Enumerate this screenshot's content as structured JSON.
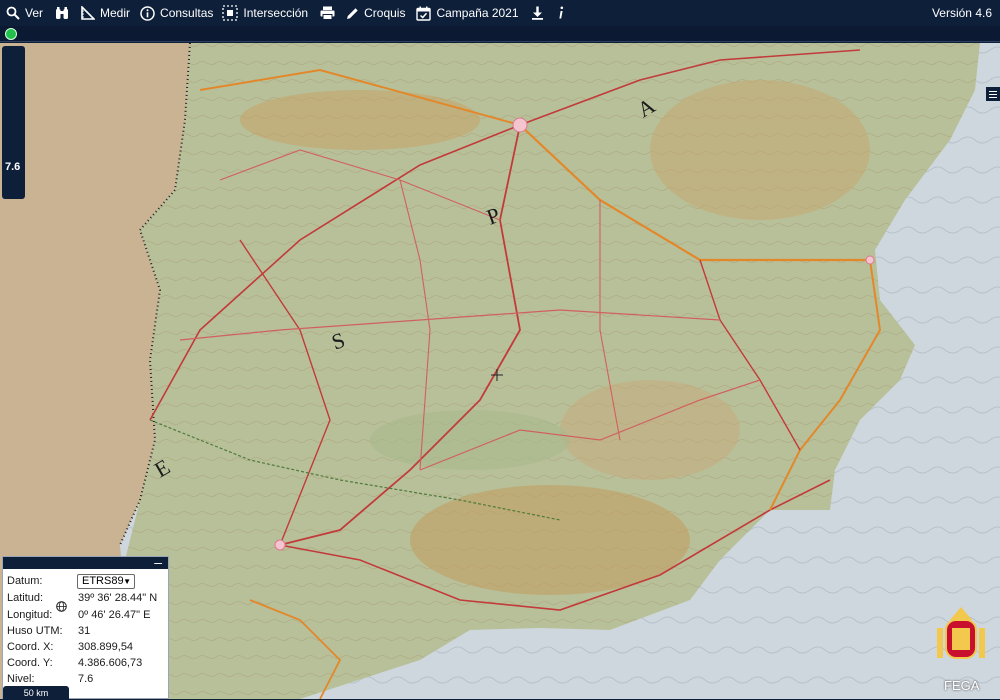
{
  "toolbar": {
    "items": [
      {
        "label": "Ver",
        "icon": "search-icon"
      },
      {
        "label": "",
        "icon": "binoculars-icon"
      },
      {
        "label": "Medir",
        "icon": "ruler-icon"
      },
      {
        "label": "Consultas",
        "icon": "info-circle-icon"
      },
      {
        "label": "Intersección",
        "icon": "intersection-icon"
      },
      {
        "label": "",
        "icon": "print-icon"
      },
      {
        "label": "Croquis",
        "icon": "pencil-icon"
      },
      {
        "label": "Campaña 2021",
        "icon": "calendar-check-icon"
      },
      {
        "label": "",
        "icon": "download-icon"
      },
      {
        "label": "",
        "icon": "info-i-icon"
      }
    ],
    "version": "Versión 4.6"
  },
  "zoom": {
    "level": "7.6"
  },
  "map": {
    "region_letters": [
      "E",
      "S",
      "P",
      "A"
    ]
  },
  "info_panel": {
    "datum_label": "Datum:",
    "datum_value": "ETRS89",
    "rows": [
      {
        "label": "Latitud:",
        "value": "39º 36' 28.44\" N"
      },
      {
        "label": "Longitud:",
        "value": "0º 46' 26.47\" E"
      },
      {
        "label": "Huso UTM:",
        "value": "31"
      },
      {
        "label": "Coord. X:",
        "value": "308.899,54"
      },
      {
        "label": "Coord. Y:",
        "value": "4.386.606,73"
      },
      {
        "label": "Nivel:",
        "value": "7.6"
      }
    ]
  },
  "scale": {
    "label": "50 km"
  },
  "footer": {
    "brand": "FEGA"
  },
  "colors": {
    "toolbar_bg": "#0e1f3a",
    "status_green": "#22c04a",
    "sea": "#cfd7de"
  }
}
